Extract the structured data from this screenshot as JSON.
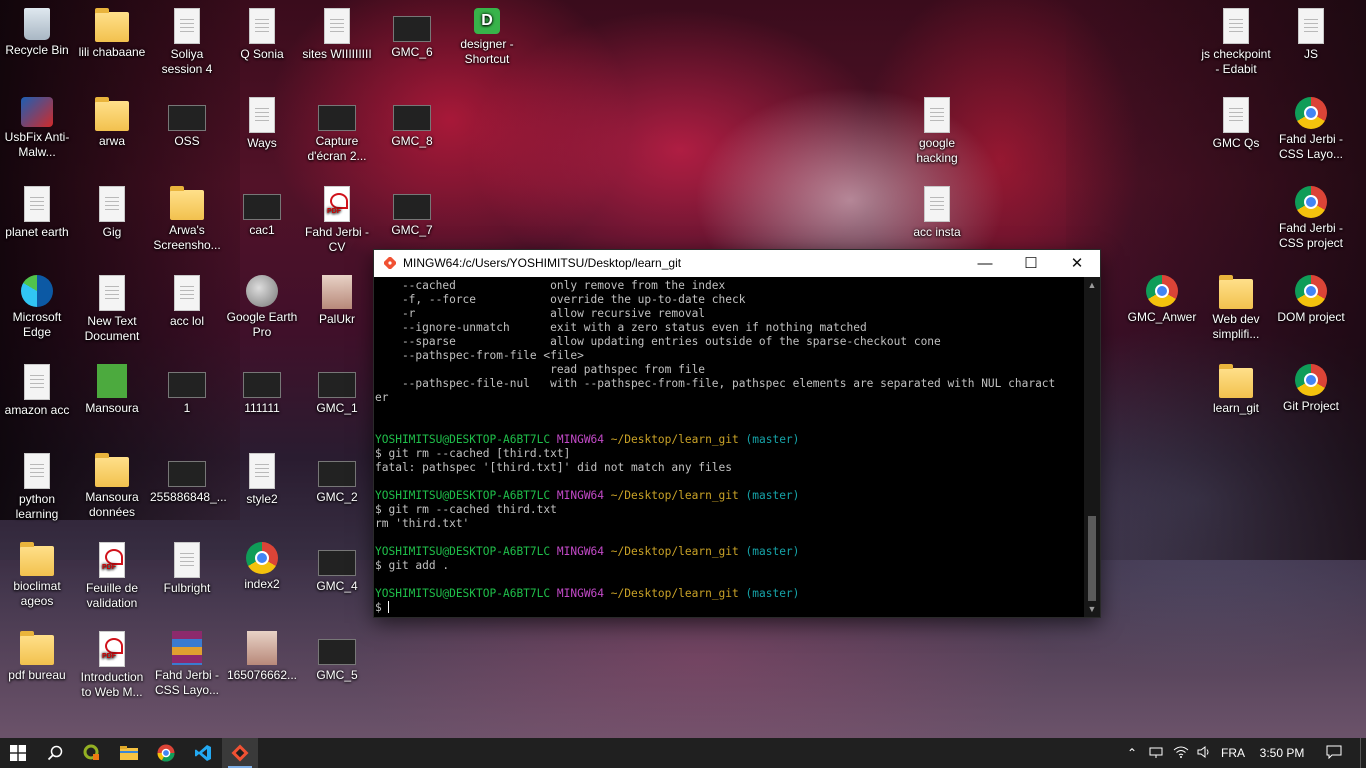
{
  "desktop_icons": [
    {
      "label": "Recycle Bin",
      "type": "bin"
    },
    {
      "label": "lili chabaane",
      "type": "folder"
    },
    {
      "label": "Soliya session 4",
      "type": "doc"
    },
    {
      "label": "Q Sonia",
      "type": "doc"
    },
    {
      "label": "sites WIIIIIIIII",
      "type": "doc"
    },
    {
      "label": "GMC_6",
      "type": "thumb"
    },
    {
      "label": "designer - Shortcut",
      "type": "greenD",
      "glyph": "D"
    },
    {
      "label": "js checkpoint - Edabit",
      "type": "doc"
    },
    {
      "label": "JS",
      "type": "doc"
    },
    {
      "label": "UsbFix Anti-Malw...",
      "type": "usb"
    },
    {
      "label": "arwa",
      "type": "folder"
    },
    {
      "label": "OSS",
      "type": "thumb"
    },
    {
      "label": "Ways",
      "type": "doc"
    },
    {
      "label": "Capture d'écran 2...",
      "type": "thumb"
    },
    {
      "label": "GMC_8",
      "type": "thumb"
    },
    {
      "label": "google hacking",
      "type": "doc"
    },
    {
      "label": "GMC Qs",
      "type": "doc"
    },
    {
      "label": "Fahd Jerbi - CSS Layo...",
      "type": "chrome"
    },
    {
      "label": "planet earth",
      "type": "doc"
    },
    {
      "label": "Gig",
      "type": "doc"
    },
    {
      "label": "Arwa's Screensho...",
      "type": "folder"
    },
    {
      "label": "cac1",
      "type": "thumb"
    },
    {
      "label": "Fahd Jerbi - CV",
      "type": "pdf"
    },
    {
      "label": "GMC_7",
      "type": "thumb"
    },
    {
      "label": "acc insta",
      "type": "doc"
    },
    {
      "label": "Fahd Jerbi - CSS project",
      "type": "chrome"
    },
    {
      "label": "Microsoft Edge",
      "type": "edge"
    },
    {
      "label": "New Text Document",
      "type": "doc"
    },
    {
      "label": "acc lol",
      "type": "doc"
    },
    {
      "label": "Google Earth Pro",
      "type": "earth"
    },
    {
      "label": "PalUkr",
      "type": "photo"
    },
    {
      "label": "GMC_Anwer",
      "type": "chrome"
    },
    {
      "label": "Web dev simplifi...",
      "type": "folder"
    },
    {
      "label": "DOM project",
      "type": "chrome"
    },
    {
      "label": "amazon acc",
      "type": "doc"
    },
    {
      "label": "Mansoura",
      "type": "green"
    },
    {
      "label": "1",
      "type": "thumb"
    },
    {
      "label": "111111",
      "type": "thumb"
    },
    {
      "label": "GMC_1",
      "type": "thumb"
    },
    {
      "label": "learn_git",
      "type": "folder"
    },
    {
      "label": "Git Project",
      "type": "chrome"
    },
    {
      "label": "python learning",
      "type": "doc"
    },
    {
      "label": "Mansoura données",
      "type": "folder"
    },
    {
      "label": "255886848_...",
      "type": "thumb"
    },
    {
      "label": "style2",
      "type": "doc"
    },
    {
      "label": "GMC_2",
      "type": "thumb"
    },
    {
      "label": "bioclimat ageos",
      "type": "folder"
    },
    {
      "label": "Feuille de validation",
      "type": "pdf"
    },
    {
      "label": "Fulbright",
      "type": "doc"
    },
    {
      "label": "index2",
      "type": "chrome"
    },
    {
      "label": "GMC_4",
      "type": "thumb"
    },
    {
      "label": "pdf bureau",
      "type": "folder"
    },
    {
      "label": "Introduction to Web M...",
      "type": "pdf"
    },
    {
      "label": "Fahd Jerbi - CSS Layo...",
      "type": "rar"
    },
    {
      "label": "165076662...",
      "type": "photo"
    },
    {
      "label": "GMC_5",
      "type": "thumb"
    }
  ],
  "terminal": {
    "title": "MINGW64:/c/Users/YOSHIMITSU/Desktop/learn_git",
    "help_lines": [
      "    --cached              only remove from the index",
      "    -f, --force           override the up-to-date check",
      "    -r                    allow recursive removal",
      "    --ignore-unmatch      exit with a zero status even if nothing matched",
      "    --sparse              allow updating entries outside of the sparse-checkout cone",
      "    --pathspec-from-file <file>",
      "                          read pathspec from file",
      "    --pathspec-file-nul   with --pathspec-from-file, pathspec elements are separated with NUL charact",
      "er"
    ],
    "prompt": {
      "user": "YOSHIMITSU@DESKTOP-A6BT7LC",
      "system": "MINGW64",
      "path": "~/Desktop/learn_git",
      "branch": "(master)"
    },
    "sessions": [
      {
        "command": "$ git rm --cached [third.txt]",
        "output": [
          "fatal: pathspec '[third.txt]' did not match any files"
        ]
      },
      {
        "command": "$ git rm --cached third.txt",
        "output": [
          "rm 'third.txt'"
        ]
      },
      {
        "command": "$ git add .",
        "output": []
      }
    ],
    "current_input": "$ "
  },
  "taskbar": {
    "apps": [
      {
        "name": "start-button",
        "icon": "windows-icon"
      },
      {
        "name": "search-button",
        "icon": "search-icon"
      },
      {
        "name": "qgis",
        "icon": "qgis-icon"
      },
      {
        "name": "file-explorer",
        "icon": "folder-icon"
      },
      {
        "name": "chrome",
        "icon": "chrome-icon"
      },
      {
        "name": "vscode",
        "icon": "vscode-icon"
      },
      {
        "name": "git-bash",
        "icon": "git-icon"
      }
    ],
    "language": "FRA",
    "time": "3:50 PM"
  }
}
